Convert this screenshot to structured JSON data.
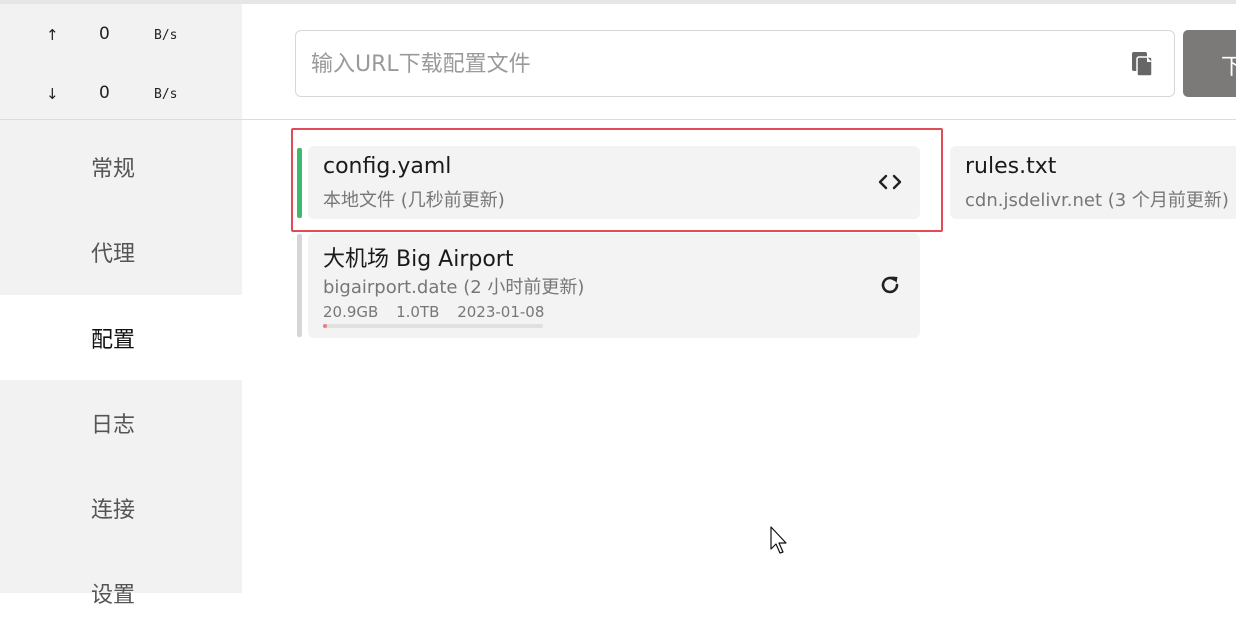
{
  "traffic": {
    "up": {
      "arrow": "↑",
      "value": "0",
      "unit": "B/s"
    },
    "down": {
      "arrow": "↓",
      "value": "0",
      "unit": "B/s"
    }
  },
  "nav": {
    "items": [
      {
        "label": "常规"
      },
      {
        "label": "代理"
      },
      {
        "label": "配置",
        "active": true
      },
      {
        "label": "日志"
      },
      {
        "label": "连接"
      },
      {
        "label": "设置"
      }
    ]
  },
  "download": {
    "placeholder": "输入URL下载配置文件",
    "value": "",
    "paste_icon": "clipboard-icon",
    "button_label": "下"
  },
  "profiles": [
    {
      "title": "config.yaml",
      "subtitle": "本地文件 (几秒前更新)",
      "action_icon": "code-icon",
      "selected": true,
      "indicator_color": "#3dba6e"
    },
    {
      "title": "rules.txt",
      "subtitle": "cdn.jsdelivr.net (3 个月前更新)"
    },
    {
      "title": "大机场 Big Airport",
      "subtitle": "bigairport.date (2 小时前更新)",
      "action_icon": "refresh-icon",
      "indicator_color": "#d6d6d6",
      "stats": {
        "used": "20.9GB",
        "total": "1.0TB",
        "expire": "2023-01-08"
      },
      "usage_fraction": 0.02
    }
  ],
  "colors": {
    "highlight": "#e04b55",
    "selected_indicator": "#3dba6e",
    "usage_fill": "#ef7a80",
    "download_button": "#7b7a78"
  }
}
